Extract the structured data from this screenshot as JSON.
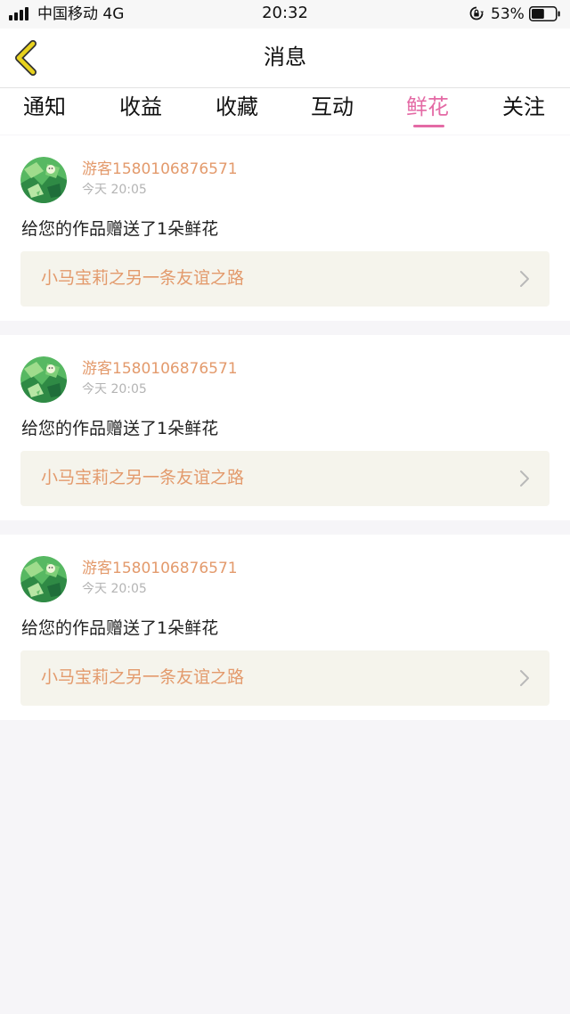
{
  "status_bar": {
    "carrier": "中国移动",
    "network": "4G",
    "time": "20:32",
    "battery_percent": "53%",
    "battery_level": 0.53
  },
  "nav": {
    "back_icon": "chevron-left-icon",
    "title": "消息",
    "accent_color": "#e46aa5",
    "back_icon_color": "#e8d21e"
  },
  "tabs": [
    {
      "label": "通知",
      "active": false
    },
    {
      "label": "收益",
      "active": false
    },
    {
      "label": "收藏",
      "active": false
    },
    {
      "label": "互动",
      "active": false
    },
    {
      "label": "鲜花",
      "active": true
    },
    {
      "label": "关注",
      "active": false
    }
  ],
  "notifications": [
    {
      "username": "游客1580106876571",
      "time": "今天 20:05",
      "message": "给您的作品赠送了1朵鲜花",
      "work_title": "小马宝莉之另一条友谊之路"
    },
    {
      "username": "游客1580106876571",
      "time": "今天 20:05",
      "message": "给您的作品赠送了1朵鲜花",
      "work_title": "小马宝莉之另一条友谊之路"
    },
    {
      "username": "游客1580106876571",
      "time": "今天 20:05",
      "message": "给您的作品赠送了1朵鲜花",
      "work_title": "小马宝莉之另一条友谊之路"
    }
  ]
}
